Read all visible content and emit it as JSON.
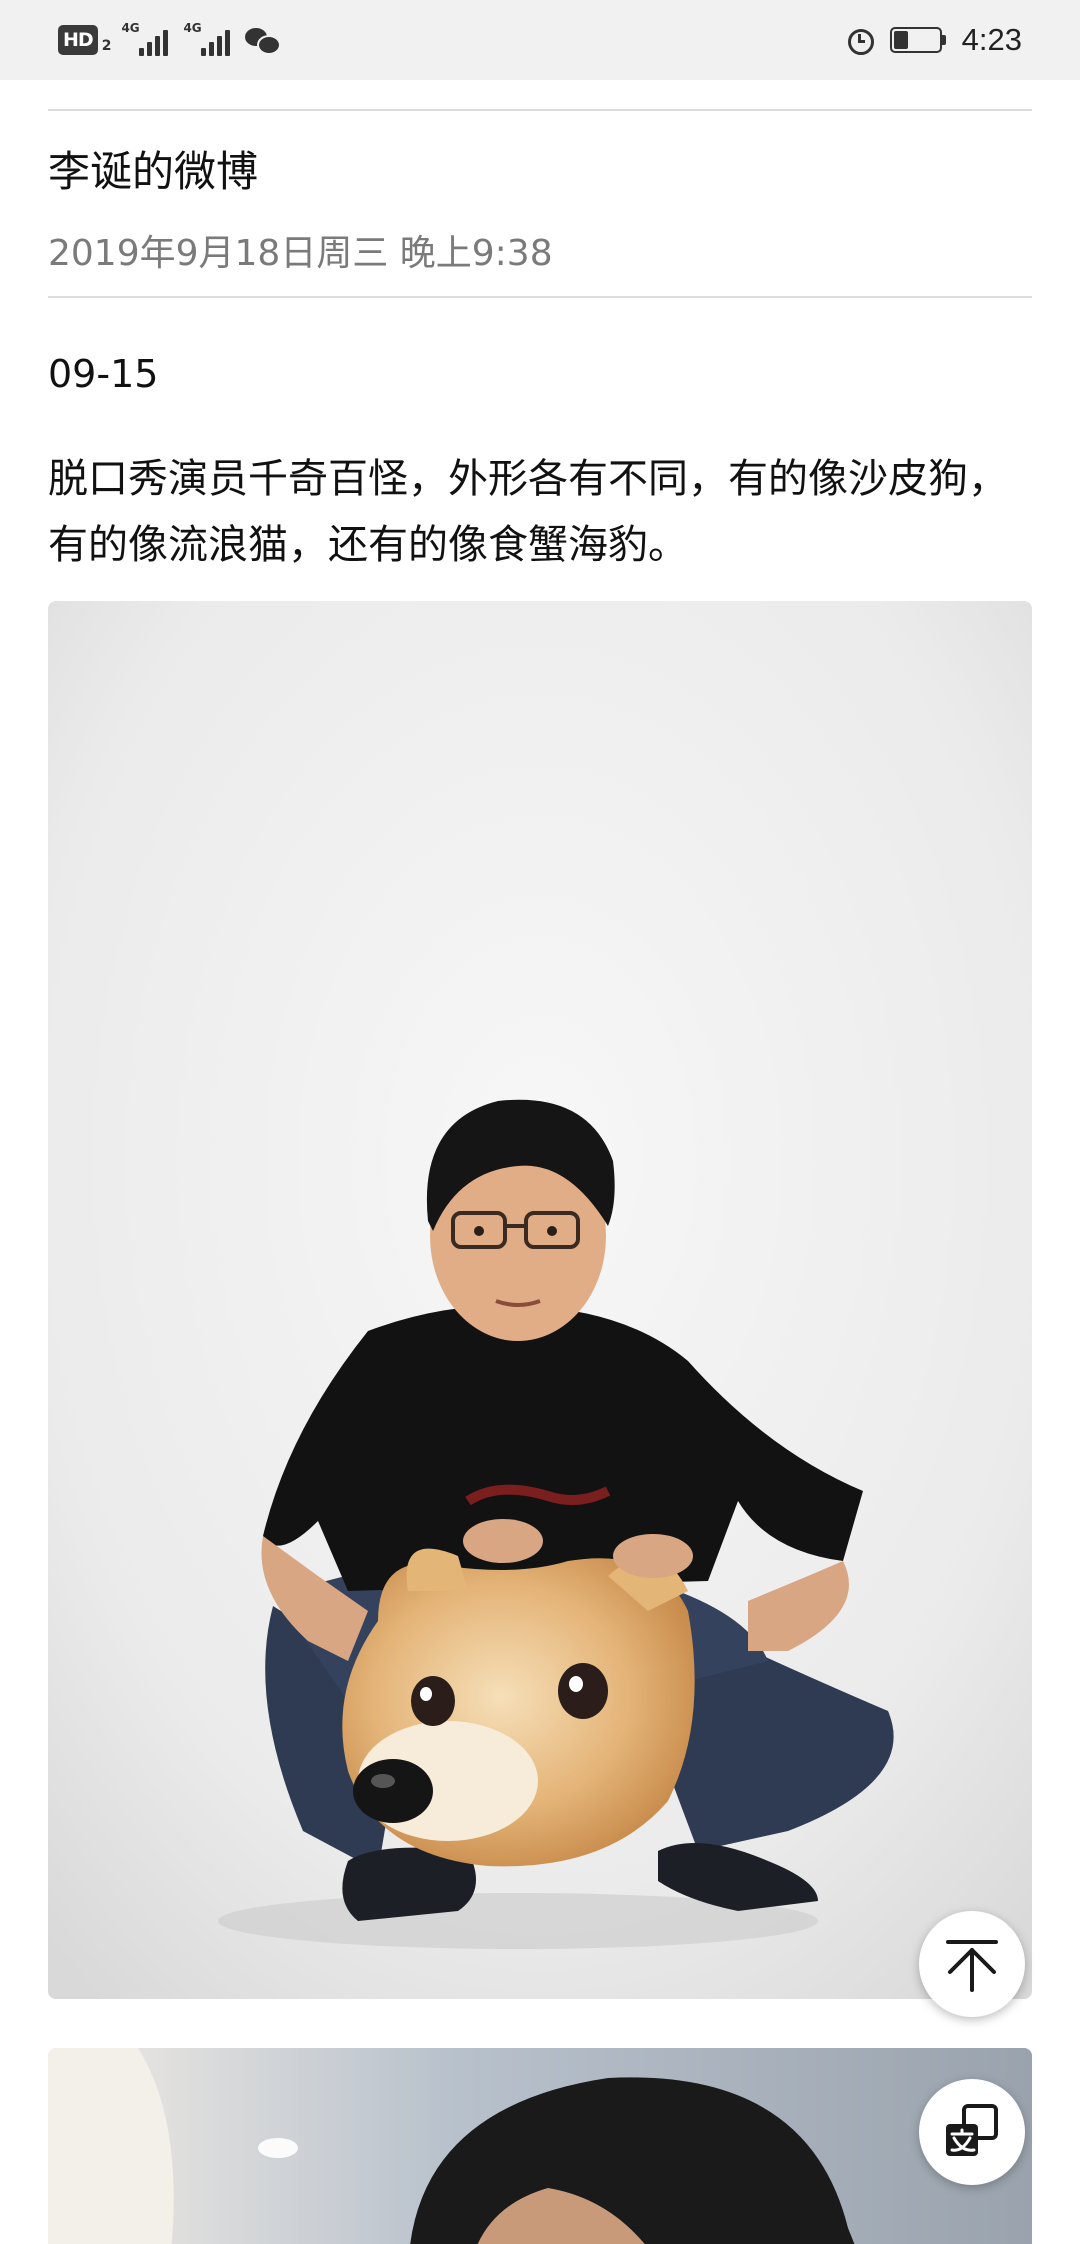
{
  "status_bar": {
    "hd_label": "HD",
    "sim_number": "2",
    "signal_1_tag": "4G",
    "signal_2_tag": "4G",
    "time": "4:23",
    "icons": [
      "hd-icon",
      "signal-icon",
      "signal-icon",
      "wechat-icon",
      "alarm-icon",
      "battery-icon"
    ]
  },
  "article": {
    "title": "李诞的微博",
    "datetime": "2019年9月18日周三 晚上9:38",
    "post_date": "09-15",
    "post_text": "脱口秀演员千奇百怪，外形各有不同，有的像沙皮狗，有的像流浪猫，还有的像食蟹海豹。"
  },
  "buttons": {
    "back_to_top_icon": "arrow-up-to-top-icon",
    "translate_icon": "translate-icon"
  },
  "colors": {
    "status_bar_bg": "#f1f1f1",
    "text_primary": "#111111",
    "text_secondary": "#7a7a7a",
    "divider": "#dcdcdc"
  }
}
